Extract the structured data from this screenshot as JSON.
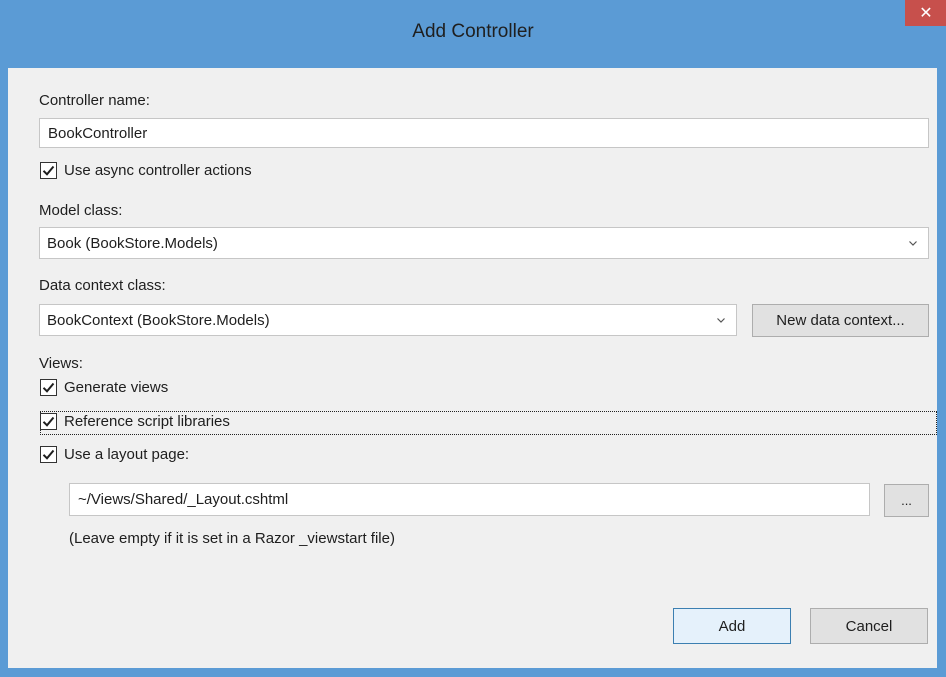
{
  "window": {
    "title": "Add Controller",
    "close_glyph": "✕"
  },
  "controller": {
    "label": "Controller name:",
    "value": "BookController"
  },
  "async": {
    "checked": true,
    "label": "Use async controller actions"
  },
  "model": {
    "label": "Model class:",
    "value": "Book (BookStore.Models)"
  },
  "context": {
    "label": "Data context class:",
    "value": "BookContext (BookStore.Models)",
    "new_button": "New data context..."
  },
  "views": {
    "label": "Views:",
    "generate": {
      "checked": true,
      "label": "Generate views"
    },
    "reference": {
      "checked": true,
      "label": "Reference script libraries"
    },
    "layout": {
      "checked": true,
      "label": "Use a layout page:"
    }
  },
  "layout_page": {
    "value": "~/Views/Shared/_Layout.cshtml",
    "browse_label": "...",
    "hint": "(Leave empty if it is set in a Razor _viewstart file)"
  },
  "buttons": {
    "add": "Add",
    "cancel": "Cancel"
  },
  "colors": {
    "titlebar": "#5b9bd5",
    "close": "#c7504c",
    "client": "#f0f0f0",
    "default_button_border": "#3c7fb1"
  },
  "icons": {
    "close": "close-icon",
    "checkmark": "checkmark-icon",
    "dropdown": "chevron-down-icon"
  }
}
